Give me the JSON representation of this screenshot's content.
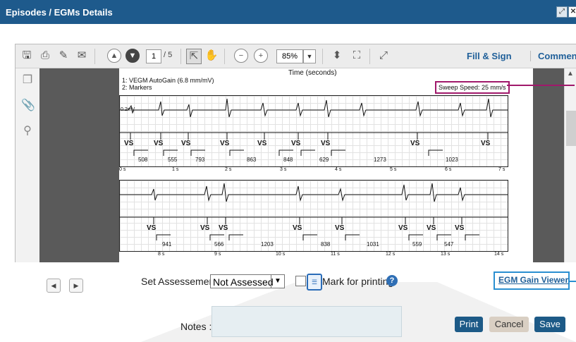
{
  "window": {
    "title": "Episodes / EGMs Details",
    "max_icon": "expand-icon",
    "close_icon": "close-icon"
  },
  "toolbar": {
    "page_current": "1",
    "page_total": "/ 5",
    "zoom": "85%",
    "fill_sign": "Fill & Sign",
    "comment": "Comment"
  },
  "document": {
    "time_header": "Time (seconds)",
    "legend_line1": "1: VEGM  AutoGain (6.8 mm/mV)",
    "legend_line2": "2: Markers",
    "sweep_speed": "Sweep Speed: 25 mm/s",
    "cal": "0.2mV",
    "strip1": {
      "markers": [
        "VS",
        "VS",
        "VS",
        "VS",
        "VS",
        "VS",
        "VS",
        "VS",
        "VS"
      ],
      "intervals": [
        "508",
        "555",
        "793",
        "863",
        "848",
        "629",
        "1273",
        "1023"
      ],
      "ticks": [
        "0 s",
        "1 s",
        "2 s",
        "3 s",
        "4 s",
        "5 s",
        "6 s",
        "7 s"
      ]
    },
    "strip2": {
      "markers": [
        "VS",
        "VS",
        "VS",
        "VS",
        "VS",
        "VS",
        "VS",
        "VS"
      ],
      "intervals": [
        "941",
        "566",
        "1203",
        "838",
        "1031",
        "559",
        "547"
      ],
      "ticks": [
        "8 s",
        "9 s",
        "10 s",
        "11 s",
        "12 s",
        "13 s",
        "14 s"
      ]
    }
  },
  "footer": {
    "assessment_label": "Set Assessement :",
    "assessment_value": "Not Assessed",
    "mark_printing": "Mark for printing",
    "gain_viewer": "EGM Gain Viewer",
    "notes_label": "Notes :",
    "notes_value": "",
    "print": "Print",
    "cancel": "Cancel",
    "save": "Save"
  },
  "colors": {
    "header": "#1e5a8c",
    "sweep_callout": "#a0196b",
    "gain_callout": "#2a8fd1",
    "button": "#1d5a87"
  }
}
